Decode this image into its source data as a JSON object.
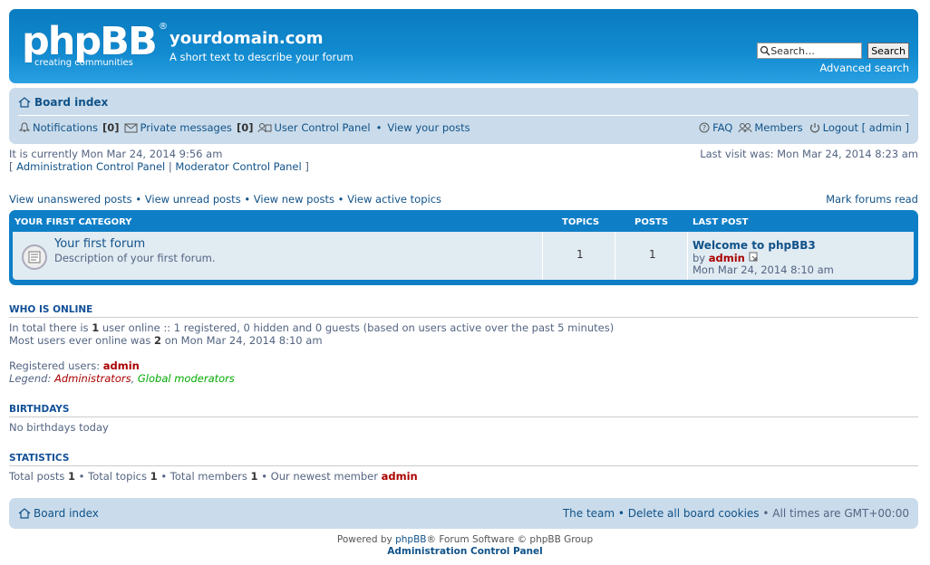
{
  "header": {
    "logo_text": "phpBB",
    "logo_sub": "creating   communities",
    "logo_reg": "®",
    "site_title": "yourdomain.com",
    "site_desc": "A short text to describe your forum",
    "search_placeholder": "Search…",
    "search_button": "Search",
    "advanced_search": "Advanced search"
  },
  "navbar": {
    "board_index": "Board index",
    "notifications": "Notifications",
    "notifications_count": "[0]",
    "private_messages": "Private messages",
    "pm_count": "[0]",
    "ucp": "User Control Panel",
    "view_posts": "View your posts",
    "faq": "FAQ",
    "members": "Members",
    "logout": "Logout [ admin ]"
  },
  "info": {
    "current_time": "It is currently Mon Mar 24, 2014 9:56 am",
    "acp_link": "Administration Control Panel",
    "mcp_link": "Moderator Control Panel",
    "last_visit": "Last visit was: Mon Mar 24, 2014 8:23 am"
  },
  "links": {
    "unanswered": "View unanswered posts",
    "unread": "View unread posts",
    "new_posts": "View new posts",
    "active": "View active topics",
    "mark_read": "Mark forums read"
  },
  "category": {
    "name": "YOUR FIRST CATEGORY",
    "col_topics": "TOPICS",
    "col_posts": "POSTS",
    "col_last": "LAST POST",
    "forum": {
      "title": "Your first forum",
      "desc": "Description of your first forum.",
      "topics": "1",
      "posts": "1",
      "last_title": "Welcome to phpBB3",
      "last_by": "by",
      "last_user": "admin",
      "last_time": "Mon Mar 24, 2014 8:10 am"
    }
  },
  "online": {
    "title": "WHO IS ONLINE",
    "l1a": "In total there is ",
    "l1n": "1",
    "l1b": " user online :: 1 registered, 0 hidden and 0 guests (based on users active over the past 5 minutes)",
    "l2a": "Most users ever online was ",
    "l2n": "2",
    "l2b": " on Mon Mar 24, 2014 8:10 am",
    "reg_label": "Registered users: ",
    "reg_user": "admin",
    "legend_label": "Legend: ",
    "legend_admin": "Administrators",
    "legend_gmod": "Global moderators"
  },
  "birthdays": {
    "title": "BIRTHDAYS",
    "text": "No birthdays today"
  },
  "stats": {
    "title": "STATISTICS",
    "posts_label": "Total posts ",
    "posts": "1",
    "topics_label": "Total topics ",
    "topics": "1",
    "members_label": "Total members ",
    "members": "1",
    "newest_label": "Our newest member ",
    "newest": "admin"
  },
  "footer": {
    "board_index": "Board index",
    "team": "The team",
    "delete_cookies": "Delete all board cookies",
    "times": "All times are GMT+00:00",
    "powered_a": "Powered by ",
    "powered_link": "phpBB",
    "powered_b": "® Forum Software © phpBB Group",
    "acp": "Administration Control Panel"
  }
}
